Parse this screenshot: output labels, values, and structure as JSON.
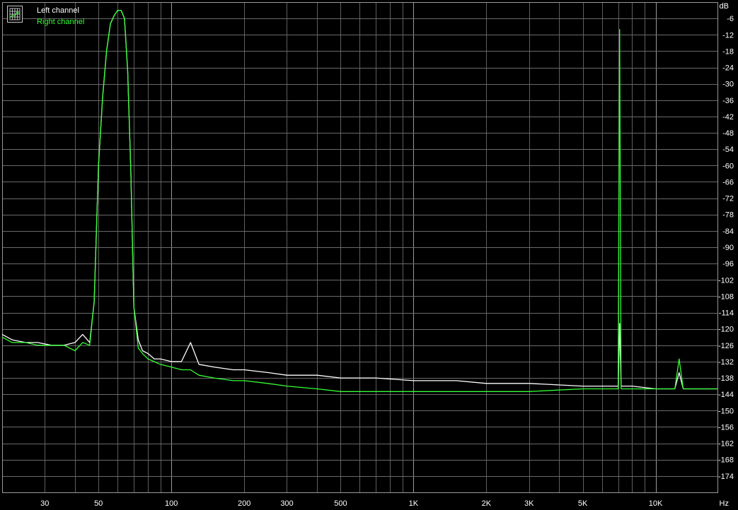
{
  "chart_data": {
    "type": "line",
    "title": "",
    "xlabel": "",
    "ylabel": "",
    "x_unit": "Hz",
    "y_unit": "dB",
    "x_scale": "log",
    "xlim": [
      20,
      18000
    ],
    "ylim": [
      -180,
      0
    ],
    "grid": true,
    "legend_position": "top-left",
    "x_ticks": [
      {
        "value": 30,
        "label": "30"
      },
      {
        "value": 50,
        "label": "50"
      },
      {
        "value": 100,
        "label": "100"
      },
      {
        "value": 200,
        "label": "200"
      },
      {
        "value": 300,
        "label": "300"
      },
      {
        "value": 500,
        "label": "500"
      },
      {
        "value": 1000,
        "label": "1K"
      },
      {
        "value": 2000,
        "label": "2K"
      },
      {
        "value": 3000,
        "label": "3K"
      },
      {
        "value": 5000,
        "label": "5K"
      },
      {
        "value": 10000,
        "label": "10K"
      }
    ],
    "y_ticks": [
      -6,
      -12,
      -18,
      -24,
      -30,
      -36,
      -42,
      -48,
      -54,
      -60,
      -66,
      -72,
      -78,
      -84,
      -90,
      -96,
      -102,
      -108,
      -114,
      -120,
      -126,
      -132,
      -138,
      -144,
      -150,
      -156,
      -162,
      -168,
      -174
    ],
    "series": [
      {
        "name": "Left channel",
        "color": "#ffffff",
        "x": [
          20,
          22,
          25,
          28,
          32,
          36,
          40,
          43,
          46,
          48,
          50,
          52,
          54,
          56,
          58,
          60,
          62,
          64,
          66,
          68,
          70,
          73,
          76,
          80,
          85,
          90,
          100,
          110,
          120,
          130,
          150,
          180,
          200,
          250,
          300,
          400,
          500,
          700,
          1000,
          1500,
          2000,
          3000,
          5000,
          6500,
          7000,
          7100,
          7200,
          7300,
          7500,
          8000,
          10000,
          11000,
          12000,
          12500,
          13000,
          15000,
          18000
        ],
        "y": [
          -122,
          -124,
          -125,
          -125,
          -126,
          -126,
          -125,
          -122,
          -125,
          -110,
          -60,
          -35,
          -18,
          -8,
          -5,
          -3,
          -3,
          -6,
          -25,
          -62,
          -112,
          -124,
          -128,
          -129,
          -131,
          -131,
          -132,
          -132,
          -125,
          -133,
          -134,
          -135,
          -135,
          -136,
          -137,
          -137,
          -138,
          -138,
          -139,
          -139,
          -140,
          -140,
          -141,
          -141,
          -141,
          -118,
          -141,
          -141,
          -141,
          -141,
          -142,
          -142,
          -142,
          -136,
          -142,
          -142,
          -142
        ]
      },
      {
        "name": "Right channel",
        "color": "#33ff33",
        "x": [
          20,
          22,
          25,
          28,
          32,
          36,
          40,
          43,
          46,
          48,
          50,
          52,
          54,
          56,
          58,
          60,
          62,
          64,
          66,
          68,
          70,
          73,
          76,
          80,
          85,
          90,
          100,
          110,
          120,
          130,
          150,
          180,
          200,
          250,
          300,
          400,
          500,
          700,
          1000,
          1500,
          2000,
          3000,
          5000,
          6500,
          7000,
          7100,
          7200,
          7300,
          7500,
          8000,
          10000,
          11000,
          12000,
          12500,
          13000,
          15000,
          18000
        ],
        "y": [
          -123,
          -125,
          -125,
          -126,
          -126,
          -126,
          -128,
          -125,
          -126,
          -110,
          -60,
          -35,
          -18,
          -8,
          -5,
          -3,
          -3,
          -6,
          -25,
          -62,
          -112,
          -127,
          -129,
          -131,
          -132,
          -133,
          -134,
          -135,
          -135,
          -137,
          -138,
          -139,
          -139,
          -140,
          -141,
          -142,
          -143,
          -143,
          -143,
          -143,
          -143,
          -143,
          -142,
          -142,
          -142,
          -10,
          -142,
          -142,
          -142,
          -142,
          -142,
          -142,
          -142,
          -131,
          -142,
          -142,
          -142
        ]
      }
    ]
  }
}
